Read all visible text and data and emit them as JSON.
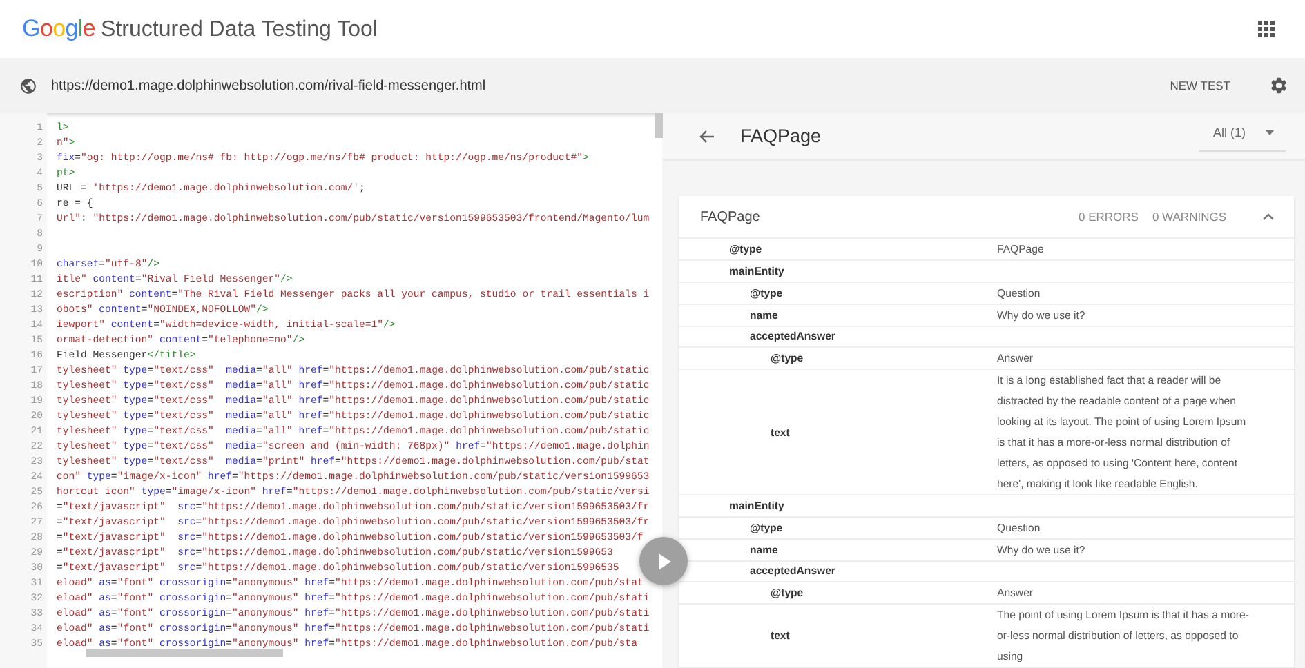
{
  "header": {
    "logo": "Google",
    "title": "Structured Data Testing Tool"
  },
  "url_bar": {
    "url": "https://demo1.mage.dolphinwebsolution.com/rival-field-messenger.html",
    "button": "NEW TEST"
  },
  "code": {
    "lines": [
      {
        "number": "1",
        "tokens": [
          {
            "kind": "tag",
            "text": "l>"
          }
        ]
      },
      {
        "number": "2",
        "tokens": [
          {
            "kind": "str",
            "text": "n\""
          },
          {
            "kind": "tag",
            "text": ">"
          }
        ]
      },
      {
        "number": "3",
        "tokens": [
          {
            "kind": "attr",
            "text": "fix"
          },
          {
            "kind": "plain",
            "text": "="
          },
          {
            "kind": "str",
            "text": "\"og: http://ogp.me/ns# fb: http://ogp.me/ns/fb# product: http://ogp.me/ns/product#\""
          },
          {
            "kind": "tag",
            "text": ">"
          }
        ]
      },
      {
        "number": "4",
        "tokens": [
          {
            "kind": "tag",
            "text": "pt>"
          }
        ]
      },
      {
        "number": "5",
        "tokens": [
          {
            "kind": "plain",
            "text": "URL = "
          },
          {
            "kind": "str",
            "text": "'https://demo1.mage.dolphinwebsolution.com/'"
          },
          {
            "kind": "plain",
            "text": ";"
          }
        ]
      },
      {
        "number": "6",
        "tokens": [
          {
            "kind": "plain",
            "text": "re = {"
          }
        ]
      },
      {
        "number": "7",
        "tokens": [
          {
            "kind": "str",
            "text": "Url\""
          },
          {
            "kind": "plain",
            "text": ": "
          },
          {
            "kind": "str",
            "text": "\"https://demo1.mage.dolphinwebsolution.com/pub/static/version1599653503/frontend/Magento/lum"
          }
        ]
      },
      {
        "number": "8"
      },
      {
        "number": "9"
      },
      {
        "number": "10",
        "tokens": [
          {
            "kind": "attr",
            "text": "charset"
          },
          {
            "kind": "plain",
            "text": "="
          },
          {
            "kind": "str",
            "text": "\"utf-8\""
          },
          {
            "kind": "tag",
            "text": "/>"
          }
        ]
      },
      {
        "number": "11",
        "tokens": [
          {
            "kind": "str",
            "text": "itle\""
          },
          {
            "kind": "attr",
            "text": " content"
          },
          {
            "kind": "plain",
            "text": "="
          },
          {
            "kind": "str",
            "text": "\"Rival Field Messenger\""
          },
          {
            "kind": "tag",
            "text": "/>"
          }
        ]
      },
      {
        "number": "12",
        "tokens": [
          {
            "kind": "str",
            "text": "escription\""
          },
          {
            "kind": "attr",
            "text": " content"
          },
          {
            "kind": "plain",
            "text": "="
          },
          {
            "kind": "str",
            "text": "\"The Rival Field Messenger packs all your campus, studio or trail essentials i"
          }
        ]
      },
      {
        "number": "13",
        "tokens": [
          {
            "kind": "str",
            "text": "obots\""
          },
          {
            "kind": "attr",
            "text": " content"
          },
          {
            "kind": "plain",
            "text": "="
          },
          {
            "kind": "str",
            "text": "\"NOINDEX,NOFOLLOW\""
          },
          {
            "kind": "tag",
            "text": "/>"
          }
        ]
      },
      {
        "number": "14",
        "tokens": [
          {
            "kind": "str",
            "text": "iewport\""
          },
          {
            "kind": "attr",
            "text": " content"
          },
          {
            "kind": "plain",
            "text": "="
          },
          {
            "kind": "str",
            "text": "\"width=device-width, initial-scale=1\""
          },
          {
            "kind": "tag",
            "text": "/>"
          }
        ]
      },
      {
        "number": "15",
        "tokens": [
          {
            "kind": "str",
            "text": "ormat-detection\""
          },
          {
            "kind": "attr",
            "text": " content"
          },
          {
            "kind": "plain",
            "text": "="
          },
          {
            "kind": "str",
            "text": "\"telephone=no\""
          },
          {
            "kind": "tag",
            "text": "/>"
          }
        ]
      },
      {
        "number": "16",
        "tokens": [
          {
            "kind": "plain",
            "text": "Field Messenger"
          },
          {
            "kind": "tag",
            "text": "</title>"
          }
        ]
      },
      {
        "number": "17",
        "tokens": [
          {
            "kind": "str",
            "text": "tylesheet\""
          },
          {
            "kind": "attr",
            "text": " type"
          },
          {
            "kind": "plain",
            "text": "="
          },
          {
            "kind": "str",
            "text": "\"text/css\""
          },
          {
            "kind": "attr",
            "text": "  media"
          },
          {
            "kind": "plain",
            "text": "="
          },
          {
            "kind": "str",
            "text": "\"all\""
          },
          {
            "kind": "attr",
            "text": " href"
          },
          {
            "kind": "plain",
            "text": "="
          },
          {
            "kind": "str",
            "text": "\"https://demo1.mage.dolphinwebsolution.com/pub/static"
          }
        ]
      },
      {
        "number": "18",
        "tokens": [
          {
            "kind": "str",
            "text": "tylesheet\""
          },
          {
            "kind": "attr",
            "text": " type"
          },
          {
            "kind": "plain",
            "text": "="
          },
          {
            "kind": "str",
            "text": "\"text/css\""
          },
          {
            "kind": "attr",
            "text": "  media"
          },
          {
            "kind": "plain",
            "text": "="
          },
          {
            "kind": "str",
            "text": "\"all\""
          },
          {
            "kind": "attr",
            "text": " href"
          },
          {
            "kind": "plain",
            "text": "="
          },
          {
            "kind": "str",
            "text": "\"https://demo1.mage.dolphinwebsolution.com/pub/static"
          }
        ]
      },
      {
        "number": "19",
        "tokens": [
          {
            "kind": "str",
            "text": "tylesheet\""
          },
          {
            "kind": "attr",
            "text": " type"
          },
          {
            "kind": "plain",
            "text": "="
          },
          {
            "kind": "str",
            "text": "\"text/css\""
          },
          {
            "kind": "attr",
            "text": "  media"
          },
          {
            "kind": "plain",
            "text": "="
          },
          {
            "kind": "str",
            "text": "\"all\""
          },
          {
            "kind": "attr",
            "text": " href"
          },
          {
            "kind": "plain",
            "text": "="
          },
          {
            "kind": "str",
            "text": "\"https://demo1.mage.dolphinwebsolution.com/pub/static"
          }
        ]
      },
      {
        "number": "20",
        "tokens": [
          {
            "kind": "str",
            "text": "tylesheet\""
          },
          {
            "kind": "attr",
            "text": " type"
          },
          {
            "kind": "plain",
            "text": "="
          },
          {
            "kind": "str",
            "text": "\"text/css\""
          },
          {
            "kind": "attr",
            "text": "  media"
          },
          {
            "kind": "plain",
            "text": "="
          },
          {
            "kind": "str",
            "text": "\"all\""
          },
          {
            "kind": "attr",
            "text": " href"
          },
          {
            "kind": "plain",
            "text": "="
          },
          {
            "kind": "str",
            "text": "\"https://demo1.mage.dolphinwebsolution.com/pub/static"
          }
        ]
      },
      {
        "number": "21",
        "tokens": [
          {
            "kind": "str",
            "text": "tylesheet\""
          },
          {
            "kind": "attr",
            "text": " type"
          },
          {
            "kind": "plain",
            "text": "="
          },
          {
            "kind": "str",
            "text": "\"text/css\""
          },
          {
            "kind": "attr",
            "text": "  media"
          },
          {
            "kind": "plain",
            "text": "="
          },
          {
            "kind": "str",
            "text": "\"all\""
          },
          {
            "kind": "attr",
            "text": " href"
          },
          {
            "kind": "plain",
            "text": "="
          },
          {
            "kind": "str",
            "text": "\"https://demo1.mage.dolphinwebsolution.com/pub/static"
          }
        ]
      },
      {
        "number": "22",
        "tokens": [
          {
            "kind": "str",
            "text": "tylesheet\""
          },
          {
            "kind": "attr",
            "text": " type"
          },
          {
            "kind": "plain",
            "text": "="
          },
          {
            "kind": "str",
            "text": "\"text/css\""
          },
          {
            "kind": "attr",
            "text": "  media"
          },
          {
            "kind": "plain",
            "text": "="
          },
          {
            "kind": "str",
            "text": "\"screen and (min-width: 768px)\""
          },
          {
            "kind": "attr",
            "text": " href"
          },
          {
            "kind": "plain",
            "text": "="
          },
          {
            "kind": "str",
            "text": "\"https://demo1.mage.dolphin"
          }
        ]
      },
      {
        "number": "23",
        "tokens": [
          {
            "kind": "str",
            "text": "tylesheet\""
          },
          {
            "kind": "attr",
            "text": " type"
          },
          {
            "kind": "plain",
            "text": "="
          },
          {
            "kind": "str",
            "text": "\"text/css\""
          },
          {
            "kind": "attr",
            "text": "  media"
          },
          {
            "kind": "plain",
            "text": "="
          },
          {
            "kind": "str",
            "text": "\"print\""
          },
          {
            "kind": "attr",
            "text": " href"
          },
          {
            "kind": "plain",
            "text": "="
          },
          {
            "kind": "str",
            "text": "\"https://demo1.mage.dolphinwebsolution.com/pub/stat"
          }
        ]
      },
      {
        "number": "24",
        "tokens": [
          {
            "kind": "str",
            "text": "con\""
          },
          {
            "kind": "attr",
            "text": " type"
          },
          {
            "kind": "plain",
            "text": "="
          },
          {
            "kind": "str",
            "text": "\"image/x-icon\""
          },
          {
            "kind": "attr",
            "text": " href"
          },
          {
            "kind": "plain",
            "text": "="
          },
          {
            "kind": "str",
            "text": "\"https://demo1.mage.dolphinwebsolution.com/pub/static/version1599653"
          }
        ]
      },
      {
        "number": "25",
        "tokens": [
          {
            "kind": "str",
            "text": "hortcut icon\""
          },
          {
            "kind": "attr",
            "text": " type"
          },
          {
            "kind": "plain",
            "text": "="
          },
          {
            "kind": "str",
            "text": "\"image/x-icon\""
          },
          {
            "kind": "attr",
            "text": " href"
          },
          {
            "kind": "plain",
            "text": "="
          },
          {
            "kind": "str",
            "text": "\"https://demo1.mage.dolphinwebsolution.com/pub/static/versi"
          }
        ]
      },
      {
        "number": "26",
        "tokens": [
          {
            "kind": "plain",
            "text": "="
          },
          {
            "kind": "str",
            "text": "\"text/javascript\""
          },
          {
            "kind": "attr",
            "text": "  src"
          },
          {
            "kind": "plain",
            "text": "="
          },
          {
            "kind": "str",
            "text": "\"https://demo1.mage.dolphinwebsolution.com/pub/static/version1599653503/fr"
          }
        ]
      },
      {
        "number": "27",
        "tokens": [
          {
            "kind": "plain",
            "text": "="
          },
          {
            "kind": "str",
            "text": "\"text/javascript\""
          },
          {
            "kind": "attr",
            "text": "  src"
          },
          {
            "kind": "plain",
            "text": "="
          },
          {
            "kind": "str",
            "text": "\"https://demo1.mage.dolphinwebsolution.com/pub/static/version1599653503/fr"
          }
        ]
      },
      {
        "number": "28",
        "tokens": [
          {
            "kind": "plain",
            "text": "="
          },
          {
            "kind": "str",
            "text": "\"text/javascript\""
          },
          {
            "kind": "attr",
            "text": "  src"
          },
          {
            "kind": "plain",
            "text": "="
          },
          {
            "kind": "str",
            "text": "\"https://demo1.mage.dolphinwebsolution.com/pub/static/version1599653503/f"
          }
        ]
      },
      {
        "number": "29",
        "tokens": [
          {
            "kind": "plain",
            "text": "="
          },
          {
            "kind": "str",
            "text": "\"text/javascript\""
          },
          {
            "kind": "attr",
            "text": "  src"
          },
          {
            "kind": "plain",
            "text": "="
          },
          {
            "kind": "str",
            "text": "\"https://demo1.mage.dolphinwebsolution.com/pub/static/version1599653"
          }
        ]
      },
      {
        "number": "30",
        "tokens": [
          {
            "kind": "plain",
            "text": "="
          },
          {
            "kind": "str",
            "text": "\"text/javascript\""
          },
          {
            "kind": "attr",
            "text": "  src"
          },
          {
            "kind": "plain",
            "text": "="
          },
          {
            "kind": "str",
            "text": "\"https://demo1.mage.dolphinwebsolution.com/pub/static/version15996535"
          }
        ]
      },
      {
        "number": "31",
        "tokens": [
          {
            "kind": "str",
            "text": "eload\""
          },
          {
            "kind": "attr",
            "text": " as"
          },
          {
            "kind": "plain",
            "text": "="
          },
          {
            "kind": "str",
            "text": "\"font\""
          },
          {
            "kind": "attr",
            "text": " crossorigin"
          },
          {
            "kind": "plain",
            "text": "="
          },
          {
            "kind": "str",
            "text": "\"anonymous\""
          },
          {
            "kind": "attr",
            "text": " href"
          },
          {
            "kind": "plain",
            "text": "="
          },
          {
            "kind": "str",
            "text": "\"https://demo1.mage.dolphinwebsolution.com/pub/stat"
          }
        ]
      },
      {
        "number": "32",
        "tokens": [
          {
            "kind": "str",
            "text": "eload\""
          },
          {
            "kind": "attr",
            "text": " as"
          },
          {
            "kind": "plain",
            "text": "="
          },
          {
            "kind": "str",
            "text": "\"font\""
          },
          {
            "kind": "attr",
            "text": " crossorigin"
          },
          {
            "kind": "plain",
            "text": "="
          },
          {
            "kind": "str",
            "text": "\"anonymous\""
          },
          {
            "kind": "attr",
            "text": " href"
          },
          {
            "kind": "plain",
            "text": "="
          },
          {
            "kind": "str",
            "text": "\"https://demo1.mage.dolphinwebsolution.com/pub/stati"
          }
        ]
      },
      {
        "number": "33",
        "tokens": [
          {
            "kind": "str",
            "text": "eload\""
          },
          {
            "kind": "attr",
            "text": " as"
          },
          {
            "kind": "plain",
            "text": "="
          },
          {
            "kind": "str",
            "text": "\"font\""
          },
          {
            "kind": "attr",
            "text": " crossorigin"
          },
          {
            "kind": "plain",
            "text": "="
          },
          {
            "kind": "str",
            "text": "\"anonymous\""
          },
          {
            "kind": "attr",
            "text": " href"
          },
          {
            "kind": "plain",
            "text": "="
          },
          {
            "kind": "str",
            "text": "\"https://demo1.mage.dolphinwebsolution.com/pub/stati"
          }
        ]
      },
      {
        "number": "34",
        "tokens": [
          {
            "kind": "str",
            "text": "eload\""
          },
          {
            "kind": "attr",
            "text": " as"
          },
          {
            "kind": "plain",
            "text": "="
          },
          {
            "kind": "str",
            "text": "\"font\""
          },
          {
            "kind": "attr",
            "text": " crossorigin"
          },
          {
            "kind": "plain",
            "text": "="
          },
          {
            "kind": "str",
            "text": "\"anonymous\""
          },
          {
            "kind": "attr",
            "text": " href"
          },
          {
            "kind": "plain",
            "text": "="
          },
          {
            "kind": "str",
            "text": "\"https://demo1.mage.dolphinwebsolution.com/pub/stati"
          }
        ]
      },
      {
        "number": "35",
        "tokens": [
          {
            "kind": "str",
            "text": "eload\""
          },
          {
            "kind": "attr",
            "text": " as"
          },
          {
            "kind": "plain",
            "text": "="
          },
          {
            "kind": "str",
            "text": "\"font\""
          },
          {
            "kind": "attr",
            "text": " crossorigin"
          },
          {
            "kind": "plain",
            "text": "="
          },
          {
            "kind": "str",
            "text": "\"anonymous\""
          },
          {
            "kind": "attr",
            "text": " href"
          },
          {
            "kind": "plain",
            "text": "="
          },
          {
            "kind": "str",
            "text": "\"https://demo1.mage.dolphinwebsolution.com/pub/sta"
          }
        ]
      }
    ]
  },
  "results": {
    "title": "FAQPage",
    "filter": "All (1)",
    "card": {
      "title": "FAQPage",
      "errors": "0 ERRORS",
      "warnings": "0 WARNINGS",
      "expanded": true,
      "properties": [
        {
          "key": "@type",
          "value": "FAQPage"
        },
        {
          "key": "mainEntity",
          "children": [
            {
              "key": "@type",
              "value": "Question"
            },
            {
              "key": "name",
              "value": "Why do we use it?"
            },
            {
              "key": "acceptedAnswer",
              "children": [
                {
                  "key": "@type",
                  "value": "Answer"
                },
                {
                  "key": "text",
                  "value": "It is a long established fact that a reader will be distracted by the readable content of a page when looking at its layout. The point of using Lorem Ipsum is that it has a more-or-less normal distribution of letters, as opposed to using 'Content here, content here', making it look like readable English."
                }
              ]
            }
          ]
        },
        {
          "key": "mainEntity",
          "children": [
            {
              "key": "@type",
              "value": "Question"
            },
            {
              "key": "name",
              "value": "Why do we use it?"
            },
            {
              "key": "acceptedAnswer",
              "children": [
                {
                  "key": "@type",
                  "value": "Answer"
                },
                {
                  "key": "text",
                  "value": "The point of using Lorem Ipsum is that it has a more-or-less normal distribution of letters, as opposed to using"
                }
              ]
            }
          ]
        }
      ]
    }
  }
}
